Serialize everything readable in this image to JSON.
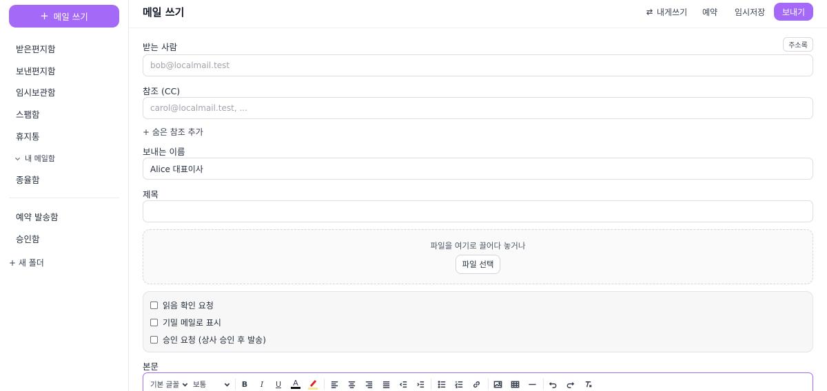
{
  "sidebar": {
    "compose_label": "메일 쓰기",
    "items": [
      {
        "label": "받은편지함"
      },
      {
        "label": "보낸편지함"
      },
      {
        "label": "임시보관함"
      },
      {
        "label": "스팸함"
      },
      {
        "label": "휴지통"
      }
    ],
    "group_label": "내 메일함",
    "group_items": [
      {
        "label": "종율함"
      }
    ],
    "extra_items": [
      {
        "label": "예약 발송함"
      },
      {
        "label": "승인함"
      }
    ],
    "new_folder_label": "+ 새 폴더"
  },
  "header": {
    "title": "메일 쓰기",
    "convert_label": "내게쓰기",
    "schedule_label": "예약",
    "draft_label": "임시저장",
    "send_label": "보내기"
  },
  "form": {
    "to_label": "받는 사람",
    "address_book_label": "주소록",
    "to_placeholder": "bob@localmail.test",
    "cc_label": "참조 (CC)",
    "cc_placeholder": "carol@localmail.test, ...",
    "bcc_link": "+ 숨은 참조 추가",
    "sender_label": "보내는 이름",
    "sender_value": "Alice 대표이사",
    "subject_label": "제목",
    "subject_value": "",
    "dropzone_text": "파일을 여기로 끌어다 놓거나",
    "file_button": "파일 선택",
    "options": [
      {
        "label": "읽음 확인 요청",
        "checked": false
      },
      {
        "label": "기밀 메일로 표시",
        "checked": false
      },
      {
        "label": "승인 요청 (상사 승인 후 발송)",
        "checked": false
      }
    ],
    "body_label": "본문"
  },
  "toolbar": {
    "font_family": "기본 글꼴",
    "font_size": "보통",
    "bold": "B",
    "italic": "I",
    "underline": "U",
    "text_color": "A",
    "colors": {
      "accent": "#a469f7",
      "text_color_bar": "#111111",
      "highlight_bar": "#fde68a",
      "highlight_pen": "#dc2626"
    }
  }
}
